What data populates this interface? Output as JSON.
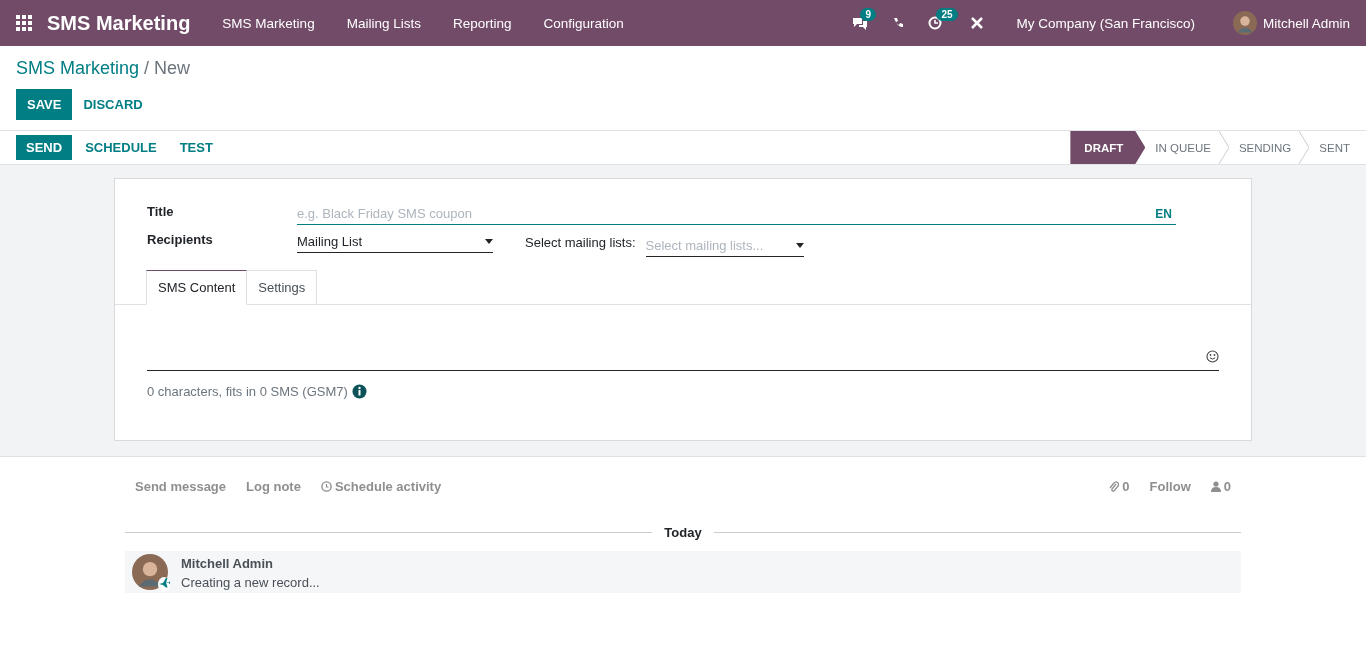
{
  "app": {
    "name": "SMS Marketing"
  },
  "menu": [
    {
      "label": "SMS Marketing"
    },
    {
      "label": "Mailing Lists"
    },
    {
      "label": "Reporting"
    },
    {
      "label": "Configuration"
    }
  ],
  "systray": {
    "messages_count": "9",
    "activities_count": "25",
    "company": "My Company (San Francisco)",
    "user": "Mitchell Admin"
  },
  "breadcrumb": {
    "parent": "SMS Marketing",
    "separator": "/",
    "current": "New"
  },
  "buttons": [
    {
      "label": "SAVE",
      "kind": "primary"
    },
    {
      "label": "DISCARD",
      "kind": "link"
    }
  ],
  "actions": [
    {
      "label": "SEND",
      "kind": "primary"
    },
    {
      "label": "SCHEDULE",
      "kind": "link"
    },
    {
      "label": "TEST",
      "kind": "link"
    }
  ],
  "stages": [
    {
      "label": "DRAFT",
      "selected": true
    },
    {
      "label": "IN QUEUE",
      "selected": false
    },
    {
      "label": "SENDING",
      "selected": false
    },
    {
      "label": "SENT",
      "selected": false
    }
  ],
  "form": {
    "title": {
      "label": "Title",
      "placeholder": "e.g. Black Friday SMS coupon",
      "lang": "EN"
    },
    "recipients": {
      "label": "Recipients",
      "value": "Mailing List"
    },
    "mailing_lists": {
      "label": "Select mailing lists:",
      "placeholder": "Select mailing lists..."
    },
    "tabs": [
      {
        "label": "SMS Content",
        "selected": true
      },
      {
        "label": "Settings",
        "selected": false
      }
    ],
    "sms_info": "0 characters, fits in 0 SMS (GSM7)"
  },
  "chatter": {
    "actions": [
      {
        "label": "Send message",
        "kind": "text"
      },
      {
        "label": "Log note",
        "kind": "text"
      },
      {
        "label": "Schedule activity",
        "kind": "activity"
      }
    ],
    "attachments": "0",
    "follow": "Follow",
    "followers": "0",
    "date": "Today",
    "messages": [
      {
        "author": "Mitchell Admin",
        "body": "Creating a new record..."
      }
    ]
  }
}
